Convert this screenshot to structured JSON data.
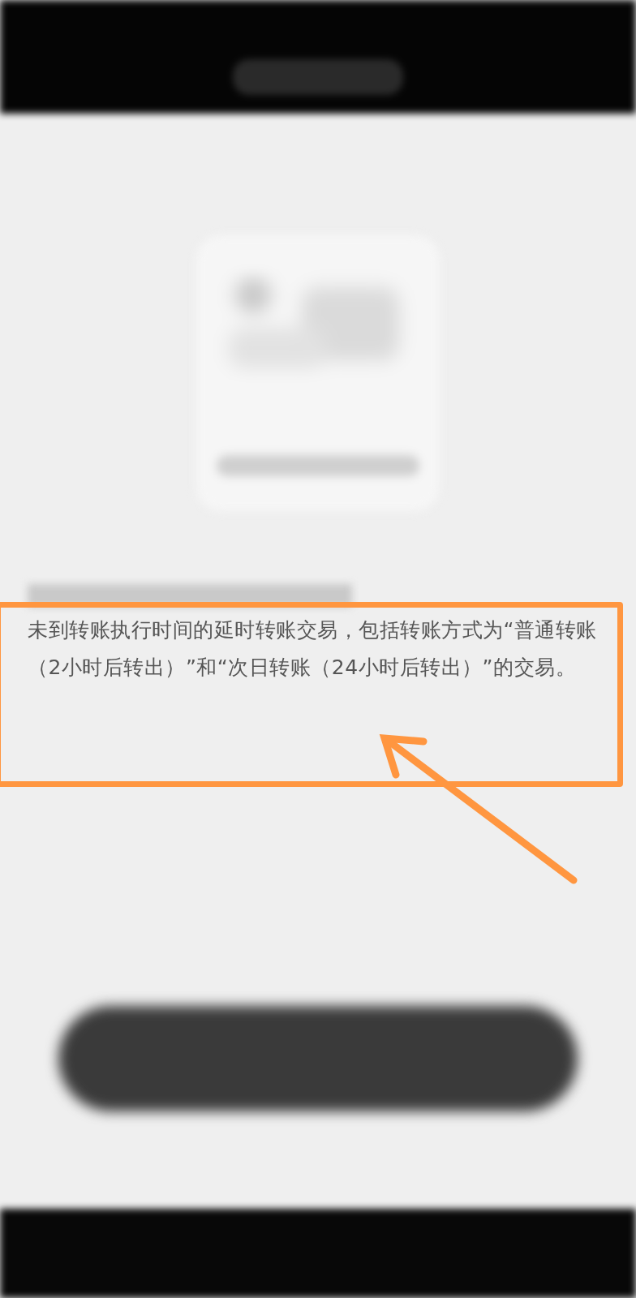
{
  "message": "未到转账执行时间的延时转账交易，包括转账方式为“普通转账（2小时后转出）”和“次日转账（24小时后转出）”的交易。"
}
